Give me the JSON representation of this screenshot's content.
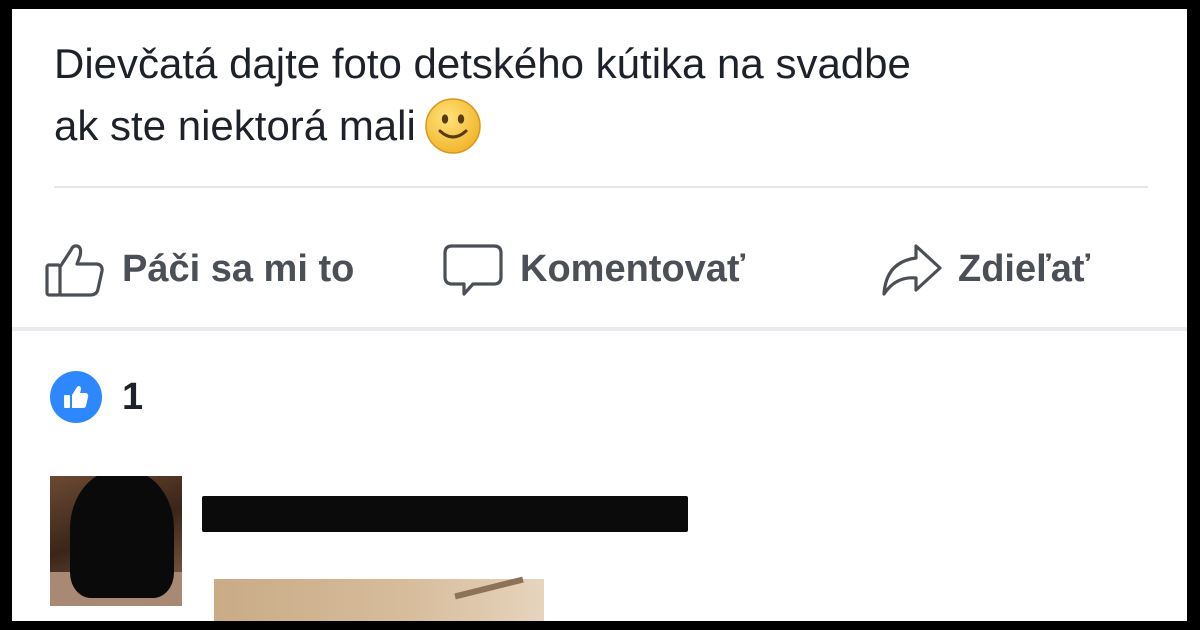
{
  "post": {
    "text_line1": "Dievčatá dajte foto detského kútika na svadbe",
    "text_line2": "ak ste niektorá mali",
    "emoji": "slightly-smiling-face"
  },
  "actions": {
    "like_label": "Páči sa mi to",
    "comment_label": "Komentovať",
    "share_label": "Zdieľať"
  },
  "reactions": {
    "icon": "thumbs-up-icon",
    "count": "1"
  },
  "colors": {
    "text": "#1d2129",
    "action_text": "#4b4f56",
    "like_badge": "#2d88ff",
    "divider": "#e4e6eb",
    "frame": "#000000"
  }
}
